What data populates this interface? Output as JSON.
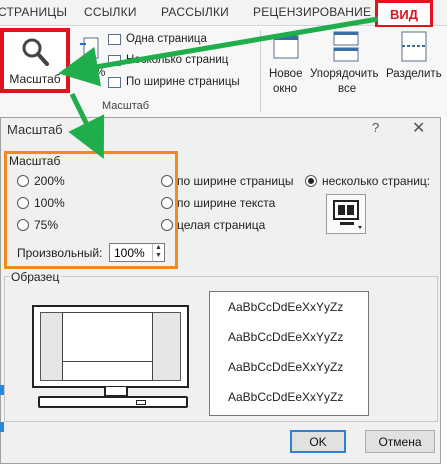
{
  "ribbon_tabs": [
    "СТРАНИЦЫ",
    "ССЫЛКИ",
    "РАССЫЛКИ",
    "РЕЦЕНЗИРОВАНИЕ"
  ],
  "active_tab": "ВИД",
  "ribbon": {
    "zoom_label": "Масштаб",
    "zoom_100": "100%",
    "one_page": "Одна страница",
    "multi_page": "Несколько страниц",
    "page_width": "По ширине страницы",
    "group_label": "Масштаб",
    "new_window_1": "Новое",
    "new_window_2": "окно",
    "arrange_1": "Упорядочить",
    "arrange_2": "все",
    "split": "Разделить"
  },
  "dialog": {
    "title": "Масштаб",
    "help": "?",
    "close": "✕",
    "zoom_group": "Масштаб",
    "options": {
      "p200": "200%",
      "p100": "100%",
      "p75": "75%",
      "page_width": "по ширине страницы",
      "text_width": "по ширине текста",
      "whole_page": "целая страница",
      "many_pages": "несколько страниц:"
    },
    "selected": "many_pages",
    "custom_label": "Произвольный:",
    "custom_value": "100%",
    "sample_group": "Образец",
    "sample_text": [
      "AaBbCcDdEeXxYyZz",
      "AaBbCcDdEeXxYyZz",
      "AaBbCcDdEeXxYyZz",
      "AaBbCcDdEeXxYyZz"
    ],
    "ok": "OK",
    "cancel": "Отмена"
  },
  "colors": {
    "highlight_red": "#e0131f",
    "highlight_orange": "#f08a26",
    "arrow_green": "#1fae4b"
  }
}
